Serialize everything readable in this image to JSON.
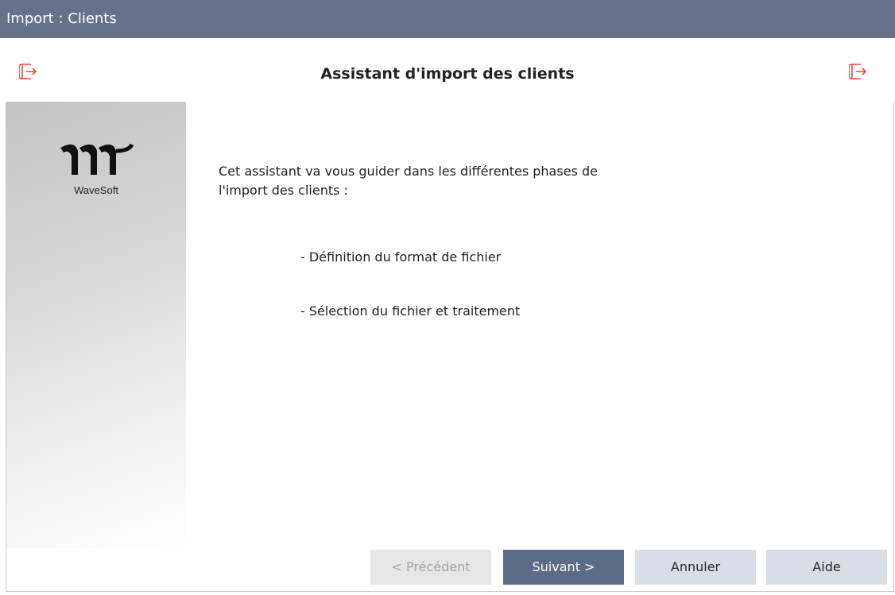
{
  "window": {
    "title": "Import : Clients"
  },
  "header": {
    "title": "Assistant d'import des clients"
  },
  "sidebar": {
    "logo_text": "WaveSoft"
  },
  "content": {
    "intro_line1": "Cet assistant va vous guider dans les différentes phases de",
    "intro_line2": "l'import des clients :",
    "steps": [
      "- Définition du format de fichier",
      "- Sélection du fichier et traitement"
    ]
  },
  "buttons": {
    "previous": "< Précédent",
    "next": "Suivant >",
    "cancel": "Annuler",
    "help": "Aide"
  },
  "colors": {
    "titlebar": "#657289",
    "primary_button": "#5d6c86",
    "secondary_button": "#d9dde5",
    "disabled_button": "#e6e6e6",
    "icon_accent": "#e84a3a"
  },
  "icons": {
    "header_left": "import-icon",
    "header_right": "import-icon"
  }
}
